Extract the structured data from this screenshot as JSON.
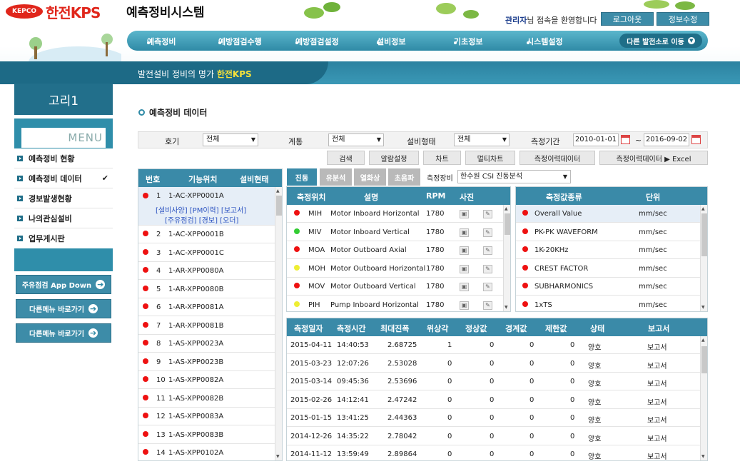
{
  "header": {
    "logo_text": "한전KPS",
    "logo_badge": "KEPCO",
    "app_title": "예측정비시스템",
    "welcome_user": "관리자",
    "welcome_rest": "님 접속을 환영합니다",
    "logout": "로그아웃",
    "info_edit": "정보수정"
  },
  "nav": {
    "items": [
      "예측정비",
      "예방점검수행",
      "예방점검설정",
      "설비정보",
      "기초정보",
      "시스템설정"
    ],
    "goto": "다른 발전소로 이동"
  },
  "band": {
    "text": "발전설비 정비의 명가 ",
    "brand": "한전KPS"
  },
  "sidebar": {
    "title": "고리1",
    "menu_head": "MENU",
    "items": [
      {
        "label": "예측정비 현황",
        "active": false
      },
      {
        "label": "예측정비 데이터",
        "active": true
      },
      {
        "label": "경보발생현황",
        "active": false
      },
      {
        "label": "나의관심설비",
        "active": false
      },
      {
        "label": "업무게시판",
        "active": false
      }
    ],
    "buttons": [
      "주유점검 App Down",
      "다른메뉴 바로가기",
      "다른메뉴 바로가기"
    ]
  },
  "page_title": "예측정비 데이터",
  "filter": {
    "unit_label": "호기",
    "unit_value": "전체",
    "system_label": "계통",
    "system_value": "전체",
    "type_label": "설비형태",
    "type_value": "전체",
    "period_label": "측정기간",
    "date_from": "2010-01-01",
    "tilde": "~",
    "date_to": "2016-09-02"
  },
  "actions": [
    "검색",
    "알람설정",
    "차트",
    "멀티차트",
    "측정이력데이터",
    "측정이력데이터 ▶ Excel"
  ],
  "equipment_list": {
    "headers": [
      "번호",
      "기능위치",
      "설비현태"
    ],
    "detail_links": "[설비사양] [PM이력] [보고서]",
    "detail_links2": "[주유점검] [경보] [오더]",
    "rows": [
      [
        "1",
        "1-AC-XPP0001A"
      ],
      [
        "2",
        "1-AC-XPP0001B"
      ],
      [
        "3",
        "1-AC-XPP0001C"
      ],
      [
        "4",
        "1-AR-XPP0080A"
      ],
      [
        "5",
        "1-AR-XPP0080B"
      ],
      [
        "6",
        "1-AR-XPP0081A"
      ],
      [
        "7",
        "1-AR-XPP0081B"
      ],
      [
        "8",
        "1-AS-XPP0023A"
      ],
      [
        "9",
        "1-AS-XPP0023B"
      ],
      [
        "10",
        "1-AS-XPP0082A"
      ],
      [
        "11",
        "1-AS-XPP0082B"
      ],
      [
        "12",
        "1-AS-XPP0083A"
      ],
      [
        "13",
        "1-AS-XPP0083B"
      ],
      [
        "14",
        "1-AS-XPP0102A"
      ]
    ]
  },
  "tabs": [
    "진동",
    "유분석",
    "열화상",
    "초음파"
  ],
  "equip_label": "측정장비",
  "equip_value": "한수원 CSI 진동분석",
  "points": {
    "headers": [
      "측정위치",
      "설명",
      "RPM",
      "사진"
    ],
    "rows": [
      {
        "status": "red",
        "code": "MIH",
        "desc": "Motor Inboard Horizontal",
        "rpm": "1780"
      },
      {
        "status": "green",
        "code": "MIV",
        "desc": "Motor Inboard Vertical",
        "rpm": "1780"
      },
      {
        "status": "red",
        "code": "MOA",
        "desc": "Motor Outboard Axial",
        "rpm": "1780"
      },
      {
        "status": "yellow",
        "code": "MOH",
        "desc": "Motor Outboard Horizontal",
        "rpm": "1780"
      },
      {
        "status": "red",
        "code": "MOV",
        "desc": "Motor Outboard Vertical",
        "rpm": "1780"
      },
      {
        "status": "yellow",
        "code": "PIH",
        "desc": "Pump Inboard Horizontal",
        "rpm": "1780"
      }
    ]
  },
  "measure_types": {
    "headers": [
      "측정값종류",
      "단위"
    ],
    "rows": [
      [
        "Overall Value",
        "mm/sec"
      ],
      [
        "PK-PK WAVEFORM",
        "mm/sec"
      ],
      [
        "1K-20KHz",
        "mm/sec"
      ],
      [
        "CREST FACTOR",
        "mm/sec"
      ],
      [
        "SUBHARMONICS",
        "mm/sec"
      ],
      [
        "1xTS",
        "mm/sec"
      ]
    ]
  },
  "history": {
    "headers": [
      "측정일자",
      "측정시간",
      "최대진폭",
      "위상각",
      "정상값",
      "경계값",
      "제한값",
      "상태",
      "보고서"
    ],
    "rows": [
      [
        "2015-04-11",
        "14:40:53",
        "2.68725",
        "1",
        "0",
        "0",
        "0",
        "양호",
        "보고서"
      ],
      [
        "2015-03-23",
        "12:07:26",
        "2.53028",
        "0",
        "0",
        "0",
        "0",
        "양호",
        "보고서"
      ],
      [
        "2015-03-14",
        "09:45:36",
        "2.53696",
        "0",
        "0",
        "0",
        "0",
        "양호",
        "보고서"
      ],
      [
        "2015-02-26",
        "14:12:41",
        "2.47242",
        "0",
        "0",
        "0",
        "0",
        "양호",
        "보고서"
      ],
      [
        "2015-01-15",
        "13:41:25",
        "2.44363",
        "0",
        "0",
        "0",
        "0",
        "양호",
        "보고서"
      ],
      [
        "2014-12-26",
        "14:35:22",
        "2.78042",
        "0",
        "0",
        "0",
        "0",
        "양호",
        "보고서"
      ],
      [
        "2014-11-12",
        "13:59:49",
        "2.89864",
        "0",
        "0",
        "0",
        "0",
        "양호",
        "보고서"
      ]
    ]
  },
  "colors": {
    "accent": "#3a8aa8",
    "brand_red": "#e0261b",
    "highlight": "#f6e13a"
  }
}
